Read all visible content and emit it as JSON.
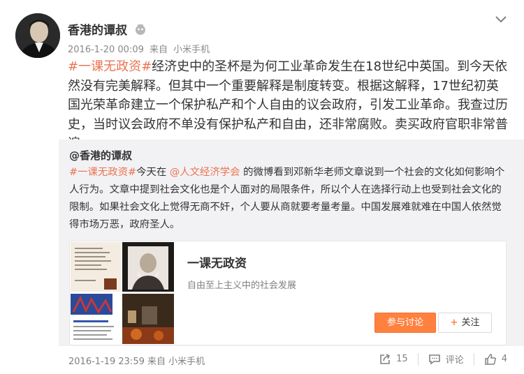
{
  "post": {
    "author": "香港的谭叔",
    "timestamp": "2016-1-20 00:09",
    "source_prefix": "来自",
    "source": "小米手机",
    "hashtag": "#一课无政资#",
    "text": "经济史中的圣杯是为何工业革命发生在18世纪中英国。到今天依然没有完美解释。但其中一个重要解释是制度转变。根据这解释，17世纪初英国光荣革命建立一个保护私产和个人自由的议会政府，引发工业革命。我查过历史，当时议会政府不单没有保护私产和自由，还非常腐败。卖买政府官职非常普遍。"
  },
  "repost": {
    "author": "@香港的谭叔",
    "hashtag": "#一课无政资#",
    "text_a": "今天在 ",
    "mention": "@人文经济学会",
    "text_b": " 的微博看到邓新华老师文章说到一个社会的文化如何影响个人行为。文章中提到社会文化也是个人面对的局限条件，所以个人在选择行动上也受到社会文化的限制。如果社会文化上觉得无商不奸，个人要从商就要考量考量。中国发展难就难在中国人依然觉得市场万恶，政府圣人。",
    "card": {
      "title": "一课无政资",
      "subtitle": "自由至上主义中的社会发展",
      "discuss_label": "参与讨论",
      "follow_label": "关注"
    }
  },
  "footer": {
    "timestamp": "2016-1-19 23:59",
    "source_prefix": "来自",
    "source": "小米手机",
    "share_count": "15",
    "comment_label": "评论",
    "like_count": "4"
  },
  "colors": {
    "accent": "#eb7350",
    "discuss_button": "#ff8140",
    "repost_background": "#f2f2f5"
  }
}
